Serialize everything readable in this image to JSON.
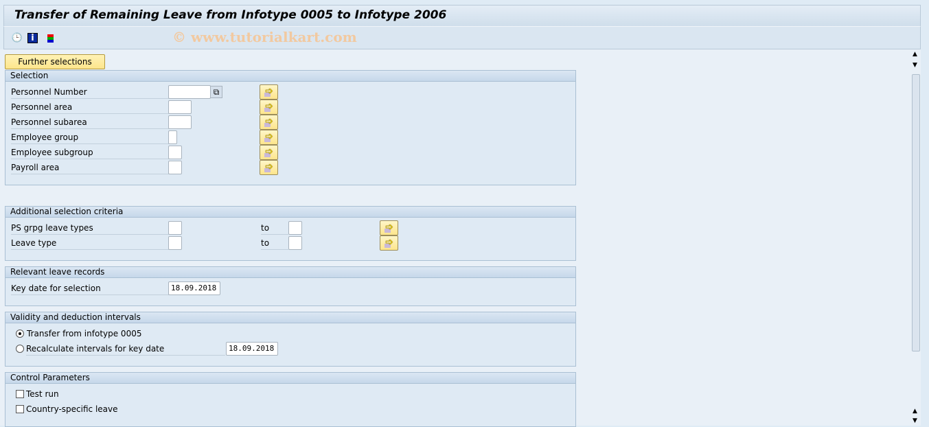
{
  "title": "Transfer of Remaining Leave from Infotype 0005 to Infotype 2006",
  "watermark": "© www.tutorialkart.com",
  "toolbar": {
    "icons": [
      "execute-icon",
      "info-icon",
      "selection-options-icon"
    ]
  },
  "further_selections": "Further selections",
  "selection": {
    "header": "Selection",
    "rows": [
      {
        "label": "Personnel Number",
        "value": ""
      },
      {
        "label": "Personnel area",
        "value": ""
      },
      {
        "label": "Personnel subarea",
        "value": ""
      },
      {
        "label": "Employee group",
        "value": ""
      },
      {
        "label": "Employee subgroup",
        "value": ""
      },
      {
        "label": "Payroll area",
        "value": ""
      }
    ]
  },
  "additional": {
    "header": "Additional selection criteria",
    "to": "to",
    "rows": [
      {
        "label": "PS grpg leave types",
        "from": "",
        "to": ""
      },
      {
        "label": "Leave type",
        "from": "",
        "to": ""
      }
    ]
  },
  "relevant": {
    "header": "Relevant leave records",
    "key_date_label": "Key date for selection",
    "key_date": "18.09.2018"
  },
  "validity": {
    "header": "Validity and deduction intervals",
    "opt1": "Transfer from infotype 0005",
    "opt2": "Recalculate intervals for key date",
    "opt2_date": "18.09.2018",
    "selected": "opt1"
  },
  "control": {
    "header": "Control Parameters",
    "test_run": "Test run",
    "test_run_checked": false,
    "country": "Country-specific leave",
    "country_checked": false
  }
}
